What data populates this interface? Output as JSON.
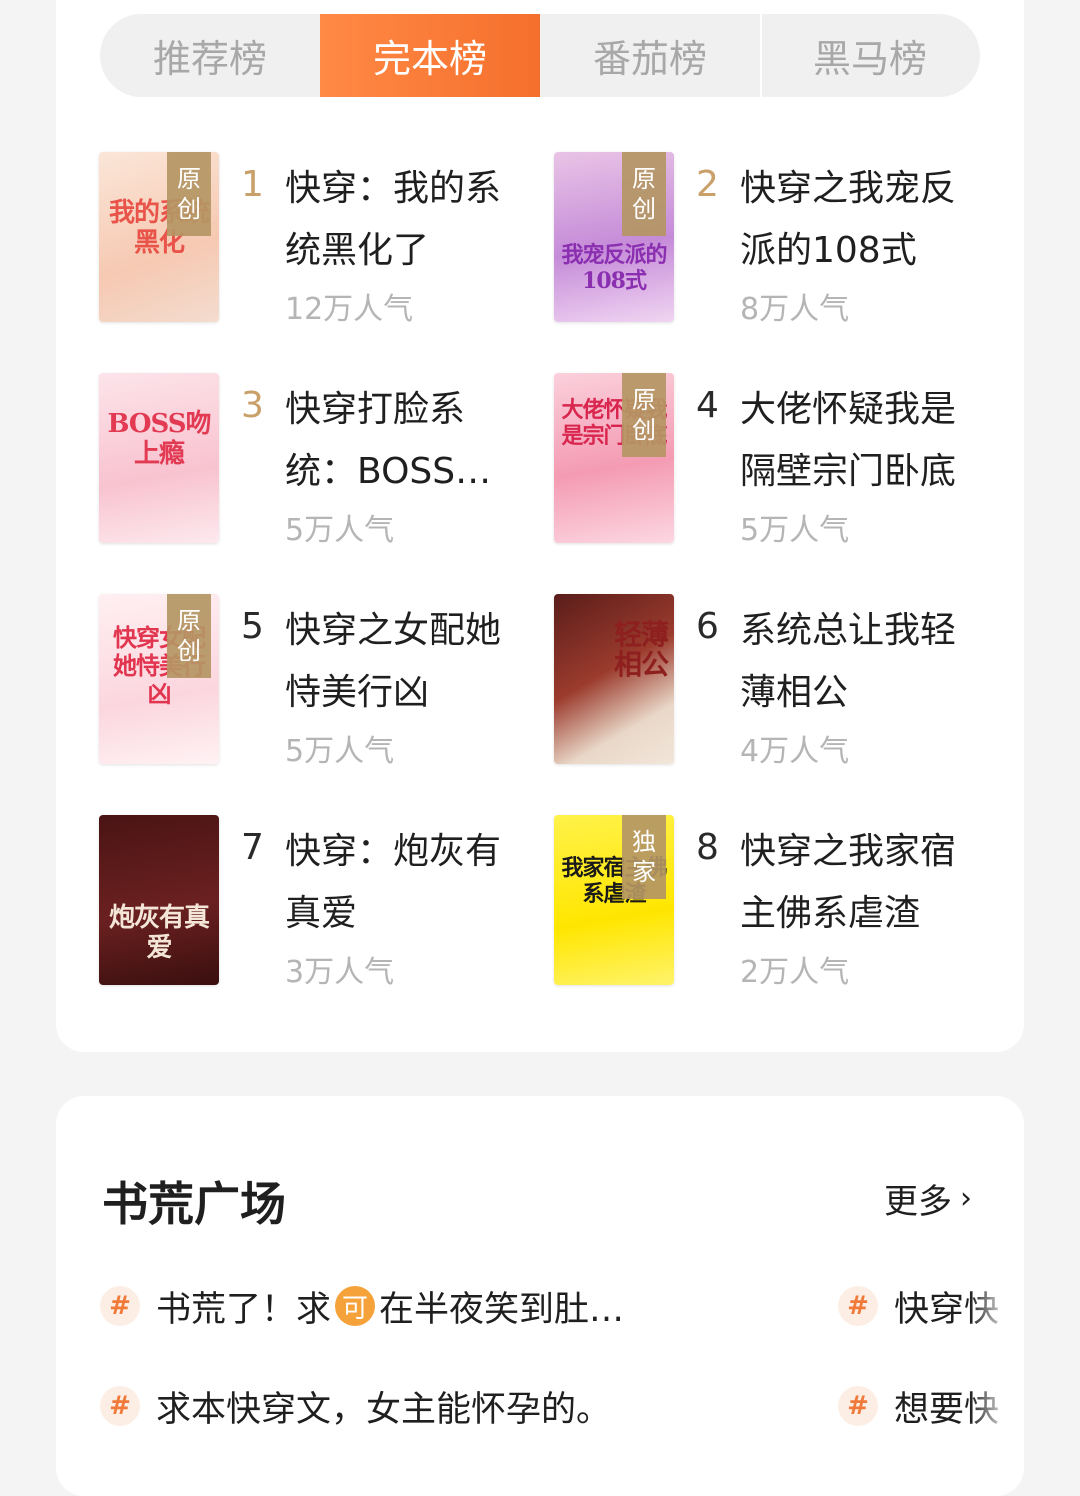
{
  "tabs": [
    {
      "label": "推荐榜",
      "active": false
    },
    {
      "label": "完本榜",
      "active": true
    },
    {
      "label": "番茄榜",
      "active": false
    },
    {
      "label": "黑马榜",
      "active": false
    }
  ],
  "books": [
    {
      "rank": "1",
      "title": "快穿：我的系统黑化了",
      "popularity": "12万人气",
      "badge": "原创",
      "cover_text": "我的系统黑化"
    },
    {
      "rank": "2",
      "title": "快穿之我宠反派的108式",
      "popularity": "8万人气",
      "badge": "原创",
      "cover_text": "我宠反派的108式"
    },
    {
      "rank": "3",
      "title": "快穿打脸系统：BOSS…",
      "popularity": "5万人气",
      "badge": "",
      "cover_text": "BOSS吻上瘾"
    },
    {
      "rank": "4",
      "title": "大佬怀疑我是隔壁宗门卧底",
      "popularity": "5万人气",
      "badge": "原创",
      "cover_text": "大佬怀疑我是宗门卧底"
    },
    {
      "rank": "5",
      "title": "快穿之女配她恃美行凶",
      "popularity": "5万人气",
      "badge": "原创",
      "cover_text": "快穿女配她恃美行凶"
    },
    {
      "rank": "6",
      "title": "系统总让我轻薄相公",
      "popularity": "4万人气",
      "badge": "",
      "cover_text": "轻薄相公"
    },
    {
      "rank": "7",
      "title": "快穿：炮灰有真爱",
      "popularity": "3万人气",
      "badge": "",
      "cover_text": "炮灰有真爱"
    },
    {
      "rank": "8",
      "title": "快穿之我家宿主佛系虐渣",
      "popularity": "2万人气",
      "badge": "独家",
      "cover_text": "我家宿主佛系虐渣"
    }
  ],
  "section": {
    "title": "书荒广场",
    "more_label": "更多",
    "topics": [
      {
        "before": "书荒了！求",
        "icon": "可",
        "after": "在半夜笑到肚…"
      },
      {
        "text": "快穿快"
      },
      {
        "text": "求本快穿文，女主能怀孕的。"
      },
      {
        "text": "想要快"
      }
    ]
  },
  "colors": {
    "accent": "#f56f2c",
    "rank_gold": "#c9a06a",
    "muted": "#b5b5b5"
  }
}
